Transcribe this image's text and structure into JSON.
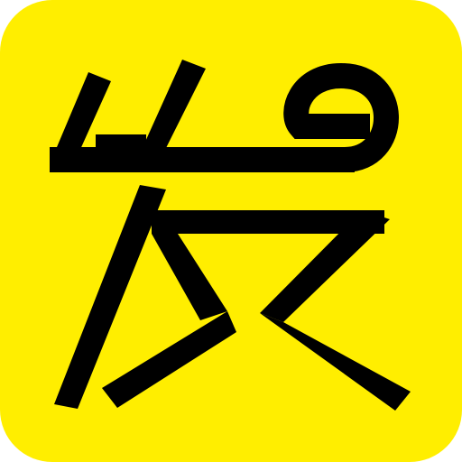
{
  "icon": {
    "glyph_text": "炭",
    "background_color": "#FFEE00",
    "glyph_color": "#000000"
  }
}
